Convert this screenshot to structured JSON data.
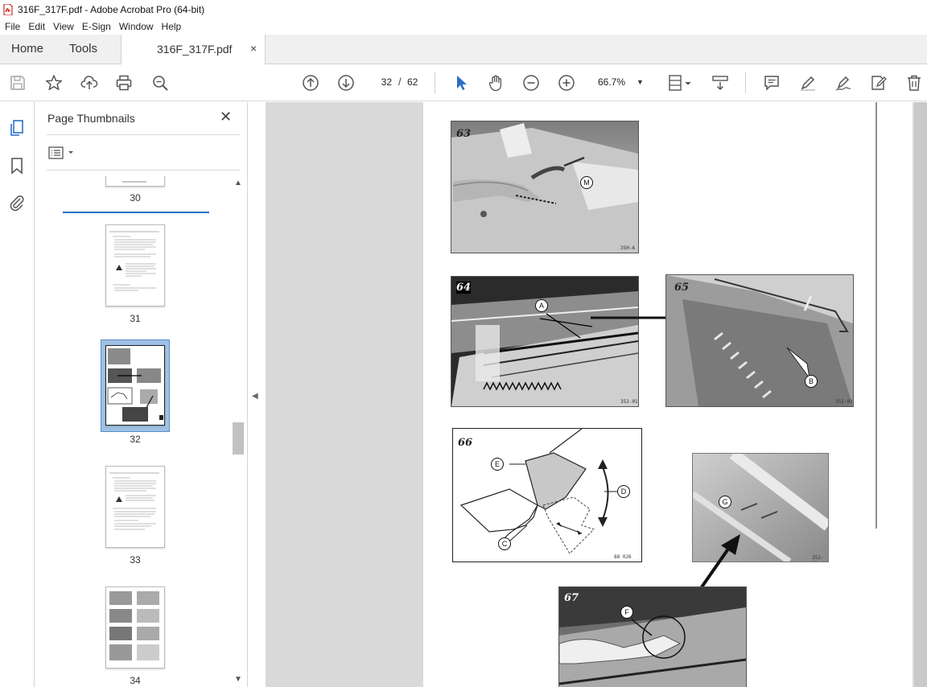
{
  "window": {
    "title": "316F_317F.pdf - Adobe Acrobat Pro (64-bit)"
  },
  "menu": [
    "File",
    "Edit",
    "View",
    "E-Sign",
    "Window",
    "Help"
  ],
  "tabs": {
    "home": "Home",
    "tools": "Tools",
    "document": "316F_317F.pdf",
    "close": "×"
  },
  "toolbar": {
    "page_current": "32",
    "page_separator": "/",
    "page_total": "62",
    "zoom": "66.7%",
    "icons": [
      "save-icon",
      "star-icon",
      "upload-icon",
      "print-icon",
      "search-zoom-icon",
      "prev-page-icon",
      "next-page-icon",
      "select-cursor-icon",
      "hand-icon",
      "zoom-out-icon",
      "zoom-in-icon",
      "page-fit-icon",
      "scroll-mode-icon",
      "comment-icon",
      "highlight-icon",
      "sign-icon",
      "edit-pdf-icon",
      "delete-icon"
    ]
  },
  "left_rail": {
    "icons": [
      "thumbnails-icon",
      "bookmarks-icon",
      "attachments-icon"
    ]
  },
  "thumbnails_panel": {
    "title": "Page Thumbnails",
    "close": "✕",
    "pages": [
      {
        "number": "30"
      },
      {
        "number": "31"
      },
      {
        "number": "32",
        "selected": true
      },
      {
        "number": "33"
      },
      {
        "number": "34"
      }
    ]
  },
  "document": {
    "figures": [
      {
        "number": "63",
        "callouts": [
          "M"
        ],
        "code": "3SH-A"
      },
      {
        "number": "64",
        "callouts": [
          "A"
        ],
        "code": "352-01"
      },
      {
        "number": "65",
        "callouts": [
          "B"
        ],
        "code": "352-03"
      },
      {
        "number": "66",
        "callouts": [
          "E",
          "D",
          "C"
        ],
        "code": "88 026"
      },
      {
        "number": "",
        "callouts": [
          "G"
        ],
        "code": "352-21"
      },
      {
        "number": "67",
        "callouts": [
          "F"
        ]
      }
    ]
  }
}
